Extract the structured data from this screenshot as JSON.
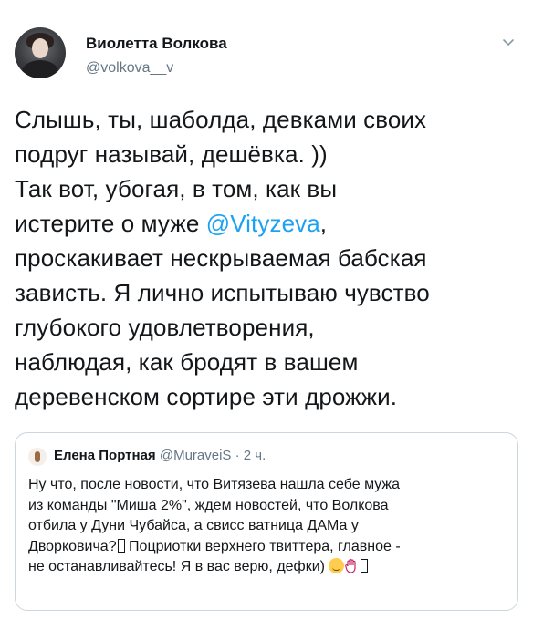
{
  "tweet": {
    "author_name": "Виолетта Волкова",
    "author_handle": "@volkova__v",
    "text_lines": [
      "Слышь, ты, шаболда, девками своих",
      "подруг называй, дешёвка. ))",
      "Так вот, убогая, в том, как вы",
      "истерите о муже ",
      "проскакивает нескрываемая бабская",
      "зависть. Я лично испытываю чувство",
      "глубокого удовлетворения,",
      "наблюдая, как бродят в вашем",
      "деревенском сортире эти дрожжи."
    ],
    "mention": "@Vityzeva",
    "after_mention": ","
  },
  "quote": {
    "author_name": "Елена Портная",
    "author_handle": "@MuraveiS",
    "separator": " · ",
    "time": "2 ч.",
    "text_lines": [
      "Ну что, после новости, что Витязева нашла себе мужа",
      "из команды \"Миша 2%\", ждем новостей, что Волкова",
      "отбила у Дуни Чубайса, а свисс ватница ДАМа у",
      "Дворковича?",
      " Поцриотки верхнего твиттера, главное -",
      "не останавливайтесь! Я в вас верю, дефки) "
    ]
  },
  "icons": {
    "avatar": "user-avatar-icon",
    "menu": "chevron-down-icon",
    "quote_avatar": "quote-author-avatar-icon",
    "emoji_smile": "smiling-face-emoji-icon",
    "emoji_hand": "raised-hand-emoji-icon",
    "missing_glyph": "missing-glyph-icon"
  },
  "colors": {
    "text": "#14171a",
    "secondary": "#657786",
    "link": "#1da1f2",
    "border": "#ccd6dd"
  }
}
